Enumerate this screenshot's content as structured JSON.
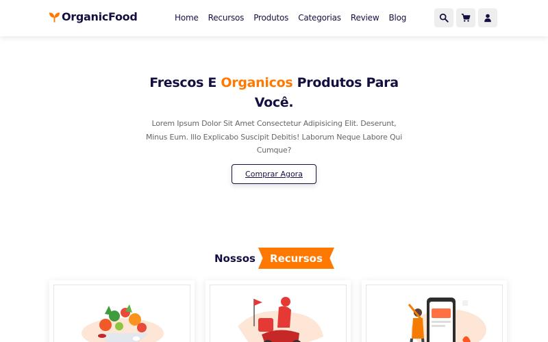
{
  "header": {
    "logo_text": "OrganicFood",
    "nav": [
      "Home",
      "Recursos",
      "Produtos",
      "Categorias",
      "Review",
      "Blog"
    ],
    "icons": [
      "search-icon",
      "cart-icon",
      "user-icon"
    ]
  },
  "hero": {
    "title_before": "Frescos E ",
    "title_accent": "Organicos",
    "title_after": " Produtos Para Você.",
    "text": "Lorem Ipsum Dolor Sit Amet Consectetur Adipisicing Elit. Deserunt, Minus Eum. Illo Explicabo Suscipit Debitis! Laborum Neque Labore Qui Cumque?",
    "button": "Comprar Agora"
  },
  "features": {
    "heading_plain": "Nossos",
    "heading_tag": "Recursos",
    "cards": [
      {
        "image": "fresh-vegetables-illustration"
      },
      {
        "image": "delivery-scooter-illustration"
      },
      {
        "image": "mobile-payment-illustration"
      }
    ]
  },
  "colors": {
    "primary": "#ff7800",
    "dark": "#130f40",
    "text_gray": "#666666",
    "icon_bg": "#eeeeee"
  }
}
